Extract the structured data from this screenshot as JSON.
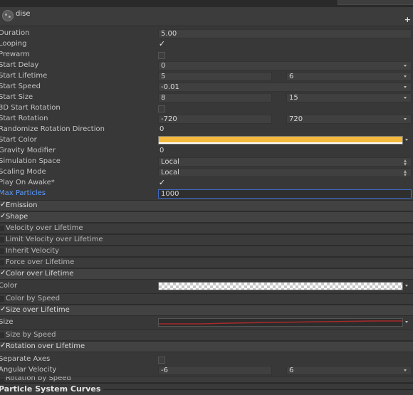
{
  "header": {
    "title": "dise",
    "add_label": "+"
  },
  "properties": [
    {
      "label": "Duration",
      "v1": "5.00",
      "type": "text"
    },
    {
      "label": "Looping",
      "type": "check",
      "checked": true
    },
    {
      "label": "Prewarm",
      "type": "box"
    },
    {
      "label": "Start Delay",
      "v1": "0",
      "type": "text",
      "arrow": true
    },
    {
      "label": "Start Lifetime",
      "v1": "5",
      "v2": "6",
      "type": "two",
      "arrow": true
    },
    {
      "label": "Start Speed",
      "v1": "-0.01",
      "type": "text",
      "arrow": true
    },
    {
      "label": "Start Size",
      "v1": "8",
      "v2": "15",
      "type": "two",
      "arrow": true
    },
    {
      "label": "3D Start Rotation",
      "type": "box"
    },
    {
      "label": "Start Rotation",
      "v1": "-720",
      "v2": "720",
      "type": "two",
      "arrow": true
    },
    {
      "label": "Randomize Rotation Direction",
      "v1": "0",
      "type": "plain"
    },
    {
      "label": "Start Color",
      "type": "color"
    },
    {
      "label": "Gravity Modifier",
      "v1": "0",
      "type": "plain"
    },
    {
      "label": "Simulation Space",
      "v1": "Local",
      "type": "select"
    },
    {
      "label": "Scaling Mode",
      "v1": "Local",
      "type": "select"
    },
    {
      "label": "Play On Awake*",
      "type": "check",
      "checked": true
    },
    {
      "label": "Max Particles",
      "v1": "1000",
      "type": "focus"
    }
  ],
  "modules": {
    "emission": "Emission",
    "shape": "Shape",
    "velocity": "Velocity over Lifetime",
    "limit_velocity": "Limit Velocity over Lifetime",
    "inherit_velocity": "Inherit Velocity",
    "force": "Force over Lifetime",
    "color_over_lifetime": "Color over Lifetime",
    "color_label": "Color",
    "color_by_speed": "Color by Speed",
    "size_over_lifetime": "Size over Lifetime",
    "size_label": "Size",
    "size_by_speed": "Size by Speed",
    "rotation_over_lifetime": "Rotation over Lifetime",
    "separate_axes_label": "Separate Axes",
    "angular_velocity_label": "Angular Velocity",
    "angular_v1": "-6",
    "angular_v2": "6",
    "rotation_by_speed": "Rotation by Speed"
  },
  "footer": {
    "title": "Particle System Curves"
  },
  "colors": {
    "start_color": "#f4b83c",
    "accent": "#3d6cc9",
    "size_curve": "#a82a2a"
  },
  "icons": [
    "particle-system-icon",
    "add-icon",
    "checkmark-icon",
    "dropdown-arrow-icon",
    "up-down-arrows-icon"
  ]
}
